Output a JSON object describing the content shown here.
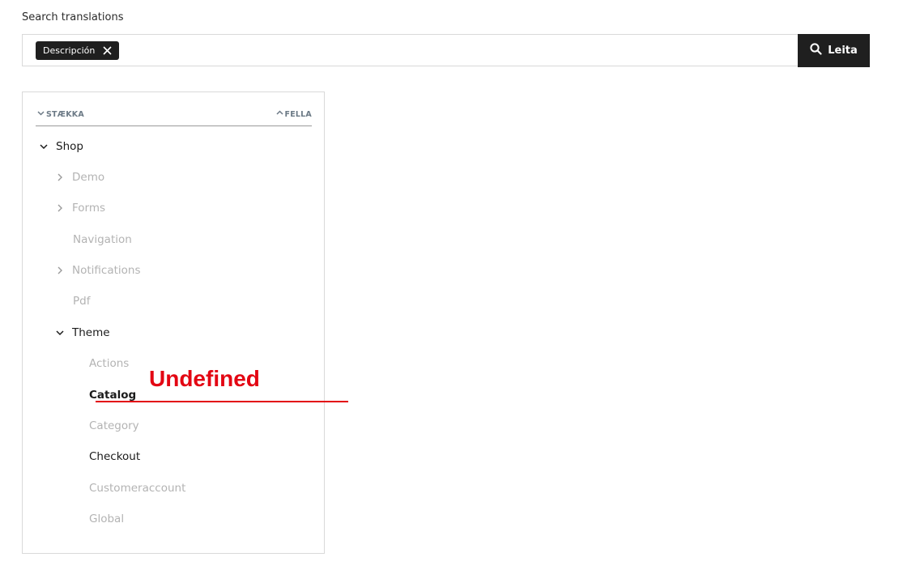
{
  "search": {
    "label": "Search translations",
    "chip_label": "Descripción",
    "button_label": "Leita"
  },
  "tree": {
    "expand_all": "STÆKKA",
    "collapse_all": "FELLA",
    "items": [
      {
        "label": "Shop"
      },
      {
        "label": "Demo"
      },
      {
        "label": "Forms"
      },
      {
        "label": "Navigation"
      },
      {
        "label": "Notifications"
      },
      {
        "label": "Pdf"
      },
      {
        "label": "Theme"
      },
      {
        "label": "Actions"
      },
      {
        "label": "Catalog"
      },
      {
        "label": "Category"
      },
      {
        "label": "Checkout"
      },
      {
        "label": "Customeraccount"
      },
      {
        "label": "Global"
      }
    ]
  },
  "annotation": {
    "text": "Undefined"
  },
  "colors": {
    "accent_dark": "#1f1f1f",
    "annotation_red": "#e30613",
    "muted_text": "#b3b3b3"
  }
}
